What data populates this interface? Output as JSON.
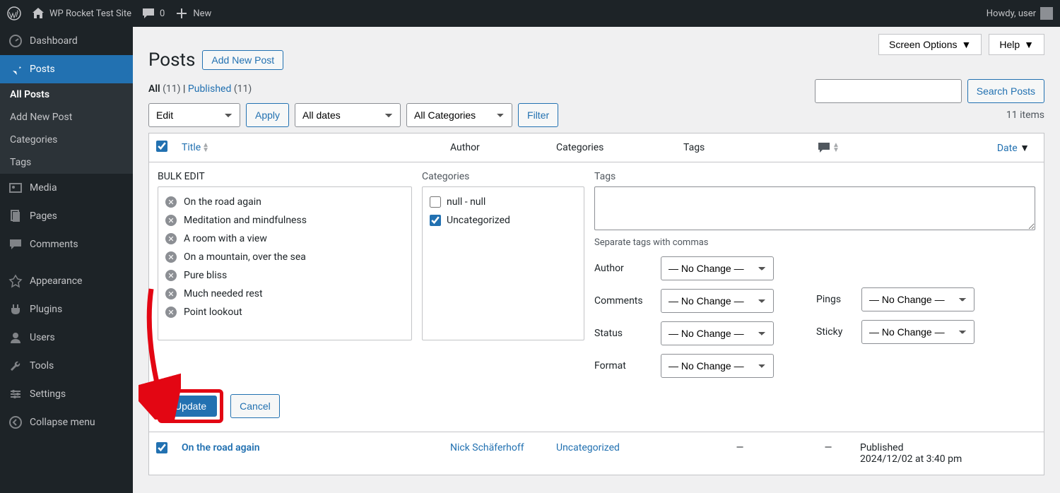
{
  "admin_bar": {
    "site_name": "WP Rocket Test Site",
    "comments_count": "0",
    "new_label": "New",
    "howdy": "Howdy, user"
  },
  "sidebar": {
    "items": [
      {
        "label": "Dashboard"
      },
      {
        "label": "Posts",
        "active": true
      },
      {
        "label": "Media"
      },
      {
        "label": "Pages"
      },
      {
        "label": "Comments"
      },
      {
        "label": "Appearance"
      },
      {
        "label": "Plugins"
      },
      {
        "label": "Users"
      },
      {
        "label": "Tools"
      },
      {
        "label": "Settings"
      },
      {
        "label": "Collapse menu"
      }
    ],
    "submenu": [
      {
        "label": "All Posts",
        "current": true
      },
      {
        "label": "Add New Post"
      },
      {
        "label": "Categories"
      },
      {
        "label": "Tags"
      }
    ]
  },
  "top_buttons": {
    "screen_options": "Screen Options",
    "help": "Help"
  },
  "page": {
    "title": "Posts",
    "add_new": "Add New Post"
  },
  "subsubsub": {
    "all_label": "All",
    "all_count": "(11)",
    "sep": " | ",
    "published_label": "Published",
    "published_count": "(11)"
  },
  "search": {
    "button": "Search Posts"
  },
  "bulk_bar": {
    "action_selected": "Edit",
    "apply": "Apply",
    "dates_selected": "All dates",
    "categories_selected": "All Categories",
    "filter": "Filter",
    "items_count": "11 items"
  },
  "table": {
    "headers": {
      "title": "Title",
      "author": "Author",
      "categories": "Categories",
      "tags": "Tags",
      "date": "Date"
    }
  },
  "bulk_edit": {
    "heading": "BULK EDIT",
    "titles": [
      "On the road again",
      "Meditation and mindfulness",
      "A room with a view",
      "On a mountain, over the sea",
      "Pure bliss",
      "Much needed rest",
      "Point lookout"
    ],
    "categories_label": "Categories",
    "categories": [
      {
        "label": "null - null",
        "checked": false
      },
      {
        "label": "Uncategorized",
        "checked": true
      }
    ],
    "tags_label": "Tags",
    "tags_hint": "Separate tags with commas",
    "fields": {
      "author": "Author",
      "comments": "Comments",
      "pings": "Pings",
      "status": "Status",
      "sticky": "Sticky",
      "format": "Format"
    },
    "no_change": "— No Change —",
    "update": "Update",
    "cancel": "Cancel"
  },
  "rows": [
    {
      "title": "On the road again",
      "author": "Nick Schäferhoff",
      "categories": "Uncategorized",
      "tags": "—",
      "comments": "—",
      "date_status": "Published",
      "date": "2024/12/02 at 3:40 pm"
    }
  ],
  "colors": {
    "accent": "#2271b1",
    "highlight": "#e30613"
  }
}
